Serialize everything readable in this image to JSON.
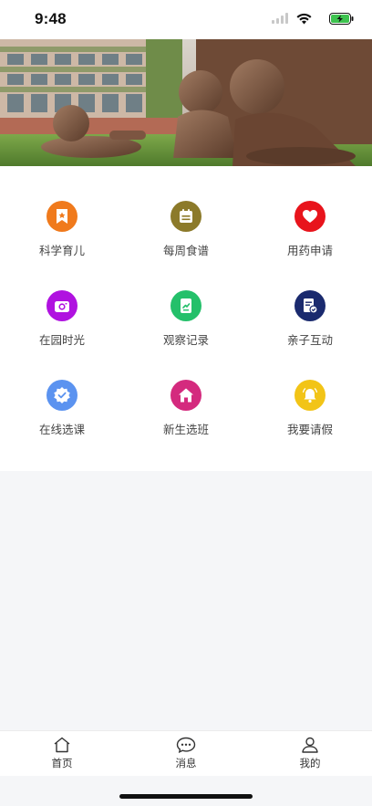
{
  "status_bar": {
    "time": "9:48",
    "icons": [
      "signal-icon",
      "wifi-icon",
      "battery-charging-icon"
    ]
  },
  "banner": {
    "image": "bronze-children-statues-photo"
  },
  "menu": {
    "items": [
      {
        "label": "科学育儿",
        "icon": "star-bookmark-icon",
        "color": "#f07a1c"
      },
      {
        "label": "每周食谱",
        "icon": "calendar-icon",
        "color": "#8c7a2a"
      },
      {
        "label": "用药申请",
        "icon": "heart-icon",
        "color": "#e8141c"
      },
      {
        "label": "在园时光",
        "icon": "camera-icon",
        "color": "#b012e0"
      },
      {
        "label": "观察记录",
        "icon": "document-chart-icon",
        "color": "#24c06a"
      },
      {
        "label": "亲子互动",
        "icon": "clipboard-check-icon",
        "color": "#1a2a6e"
      },
      {
        "label": "在线选课",
        "icon": "verified-badge-icon",
        "color": "#5b93f0"
      },
      {
        "label": "新生选班",
        "icon": "house-icon",
        "color": "#d42a7e"
      },
      {
        "label": "我要请假",
        "icon": "bell-icon",
        "color": "#f2c417"
      }
    ]
  },
  "tab_bar": {
    "tabs": [
      {
        "label": "首页",
        "icon": "home-icon"
      },
      {
        "label": "消息",
        "icon": "message-bubble-icon"
      },
      {
        "label": "我的",
        "icon": "user-icon"
      }
    ]
  }
}
